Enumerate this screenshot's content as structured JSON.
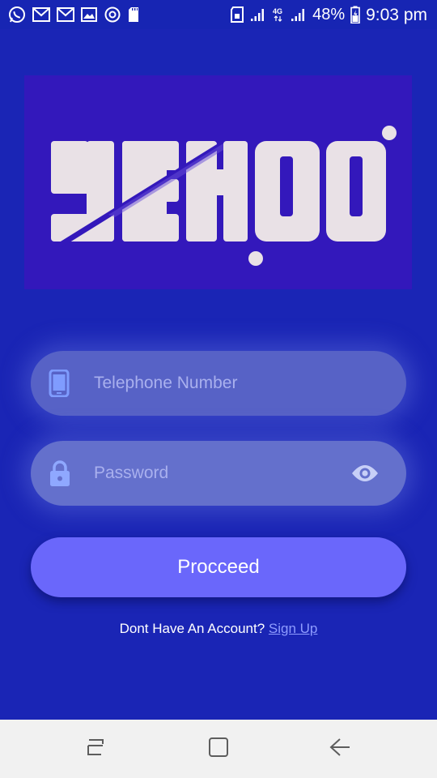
{
  "status_bar": {
    "battery": "48%",
    "time": "9:03 pm",
    "network": "4G",
    "left_icons": [
      "whatsapp-icon",
      "gmail-icon",
      "gmail-icon",
      "gallery-icon",
      "sync-icon",
      "sd-card-icon"
    ],
    "right_icons": [
      "sim-icon",
      "signal-icon",
      "signal-icon",
      "battery-icon"
    ]
  },
  "logo": {
    "text": "YEKOO",
    "background": "#3318bb",
    "letter_color": "#e9e1e6"
  },
  "form": {
    "phone_placeholder": "Telephone Number",
    "phone_icon": "phone-icon",
    "password_placeholder": "Password",
    "password_icon": "lock-icon",
    "toggle_icon": "eye-icon",
    "proceed_label": "Procceed"
  },
  "signup": {
    "prompt": "Dont Have An Account?",
    "link": "Sign Up"
  },
  "nav_bar": {
    "icons": [
      "recent-apps-icon",
      "home-icon",
      "back-icon"
    ]
  },
  "colors": {
    "background": "#1a25b5",
    "accent": "#6a67fb",
    "field": "#5a66c9",
    "link": "#8f9cff"
  }
}
